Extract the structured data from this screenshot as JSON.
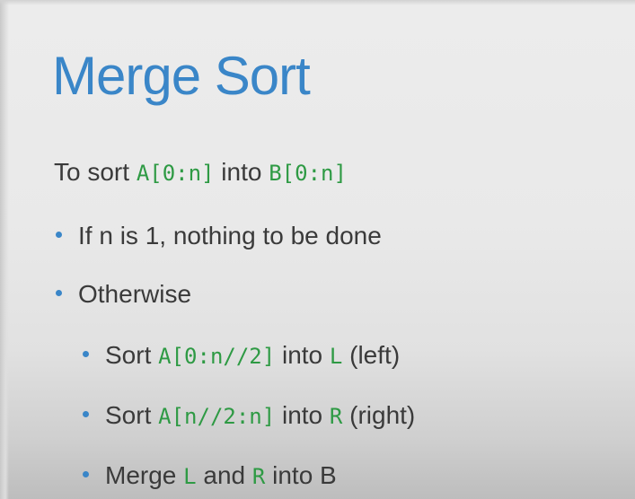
{
  "slide": {
    "title": "Merge Sort",
    "intro": {
      "prefix": "To sort",
      "code_a": "A[0:n]",
      "middle": "into",
      "code_b": "B[0:n]"
    },
    "bullets": [
      {
        "text": "If n is 1, nothing to be done"
      },
      {
        "text": "Otherwise"
      }
    ],
    "sub_bullets": [
      {
        "prefix": "Sort",
        "code": "A[0:n//2]",
        "middle": "into",
        "code2": "L",
        "suffix": "(left)"
      },
      {
        "prefix": "Sort",
        "code": "A[n//2:n]",
        "middle": "into",
        "code2": "R",
        "suffix": "(right)"
      },
      {
        "prefix": "Merge",
        "code": "L",
        "middle": "and",
        "code2": "R",
        "suffix": "into B"
      }
    ]
  },
  "colors": {
    "title": "#3a86c8",
    "code": "#2e9a44",
    "text": "#3a3a3a",
    "bullet": "#3a86c8"
  }
}
